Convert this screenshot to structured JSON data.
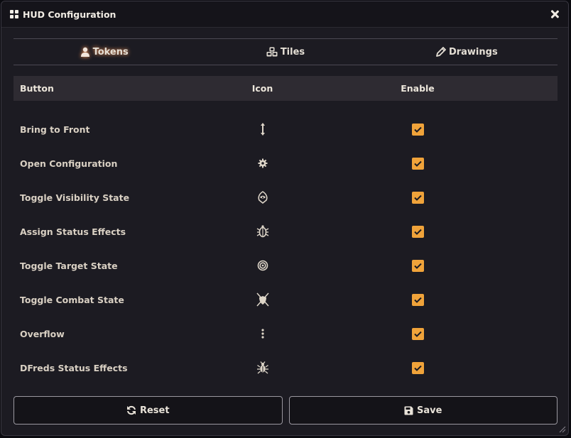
{
  "window": {
    "title": "HUD Configuration",
    "title_icon": "grid-icon",
    "close_icon": "close-icon"
  },
  "tabs": [
    {
      "label": "Tokens",
      "icon": "user-icon",
      "active": true
    },
    {
      "label": "Tiles",
      "icon": "cubes-icon",
      "active": false
    },
    {
      "label": "Drawings",
      "icon": "pencil-icon",
      "active": false
    }
  ],
  "table": {
    "headers": {
      "button": "Button",
      "icon": "Icon",
      "enable": "Enable"
    },
    "rows": [
      {
        "label": "Bring to Front",
        "icon": "arrows-up-down-icon",
        "enabled": true
      },
      {
        "label": "Open Configuration",
        "icon": "gear-icon",
        "enabled": true
      },
      {
        "label": "Toggle Visibility State",
        "icon": "hooded-figure-icon",
        "enabled": true
      },
      {
        "label": "Assign Status Effects",
        "icon": "beetle-icon",
        "enabled": true
      },
      {
        "label": "Toggle Target State",
        "icon": "bullseye-icon",
        "enabled": true
      },
      {
        "label": "Toggle Combat State",
        "icon": "crossed-swords-shield-icon",
        "enabled": true
      },
      {
        "label": "Overflow",
        "icon": "vertical-ellipsis-icon",
        "enabled": true
      },
      {
        "label": "DFreds Status Effects",
        "icon": "bug-icon",
        "enabled": true
      }
    ]
  },
  "footer": {
    "reset_label": "Reset",
    "save_label": "Save"
  },
  "colors": {
    "accent": "#f0a33a",
    "window_bg": "#1c1b22",
    "header_bg": "#2e2b32"
  }
}
